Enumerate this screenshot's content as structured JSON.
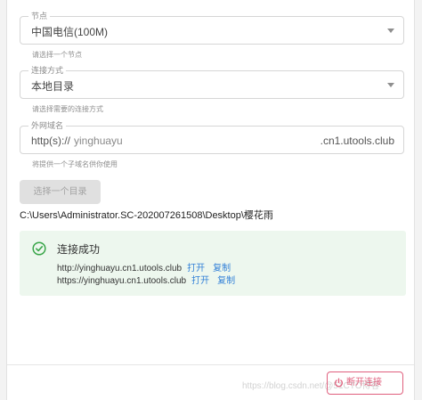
{
  "node_field": {
    "legend": "节点",
    "value": "中国电信(100M)",
    "helper": "请选择一个节点"
  },
  "method_field": {
    "legend": "连接方式",
    "value": "本地目录",
    "helper": "请选择需要的连接方式"
  },
  "domain_field": {
    "legend": "外网域名",
    "prefix": "http(s)://",
    "value": "yinghuayu",
    "suffix": ".cn1.utools.club",
    "helper": "将提供一个子域名供你使用"
  },
  "directory": {
    "button_label": "选择一个目录",
    "path": "C:\\Users\\Administrator.SC-202007261508\\Desktop\\樱花雨"
  },
  "connection": {
    "title": "连接成功",
    "urls": [
      {
        "url": "http://yinghuayu.cn1.utools.club",
        "open_label": "打开",
        "copy_label": "复制"
      },
      {
        "url": "https://yinghuayu.cn1.utools.club",
        "open_label": "打开",
        "copy_label": "复制"
      }
    ]
  },
  "footer": {
    "disconnect_label": "断开连接",
    "watermark": "https://blog.csdn.net/@51CTO博客"
  },
  "colors": {
    "accent_link": "#3582d8",
    "success_bg": "#edf7ee",
    "success_icon": "#3aa64a",
    "danger": "#e0607e"
  }
}
